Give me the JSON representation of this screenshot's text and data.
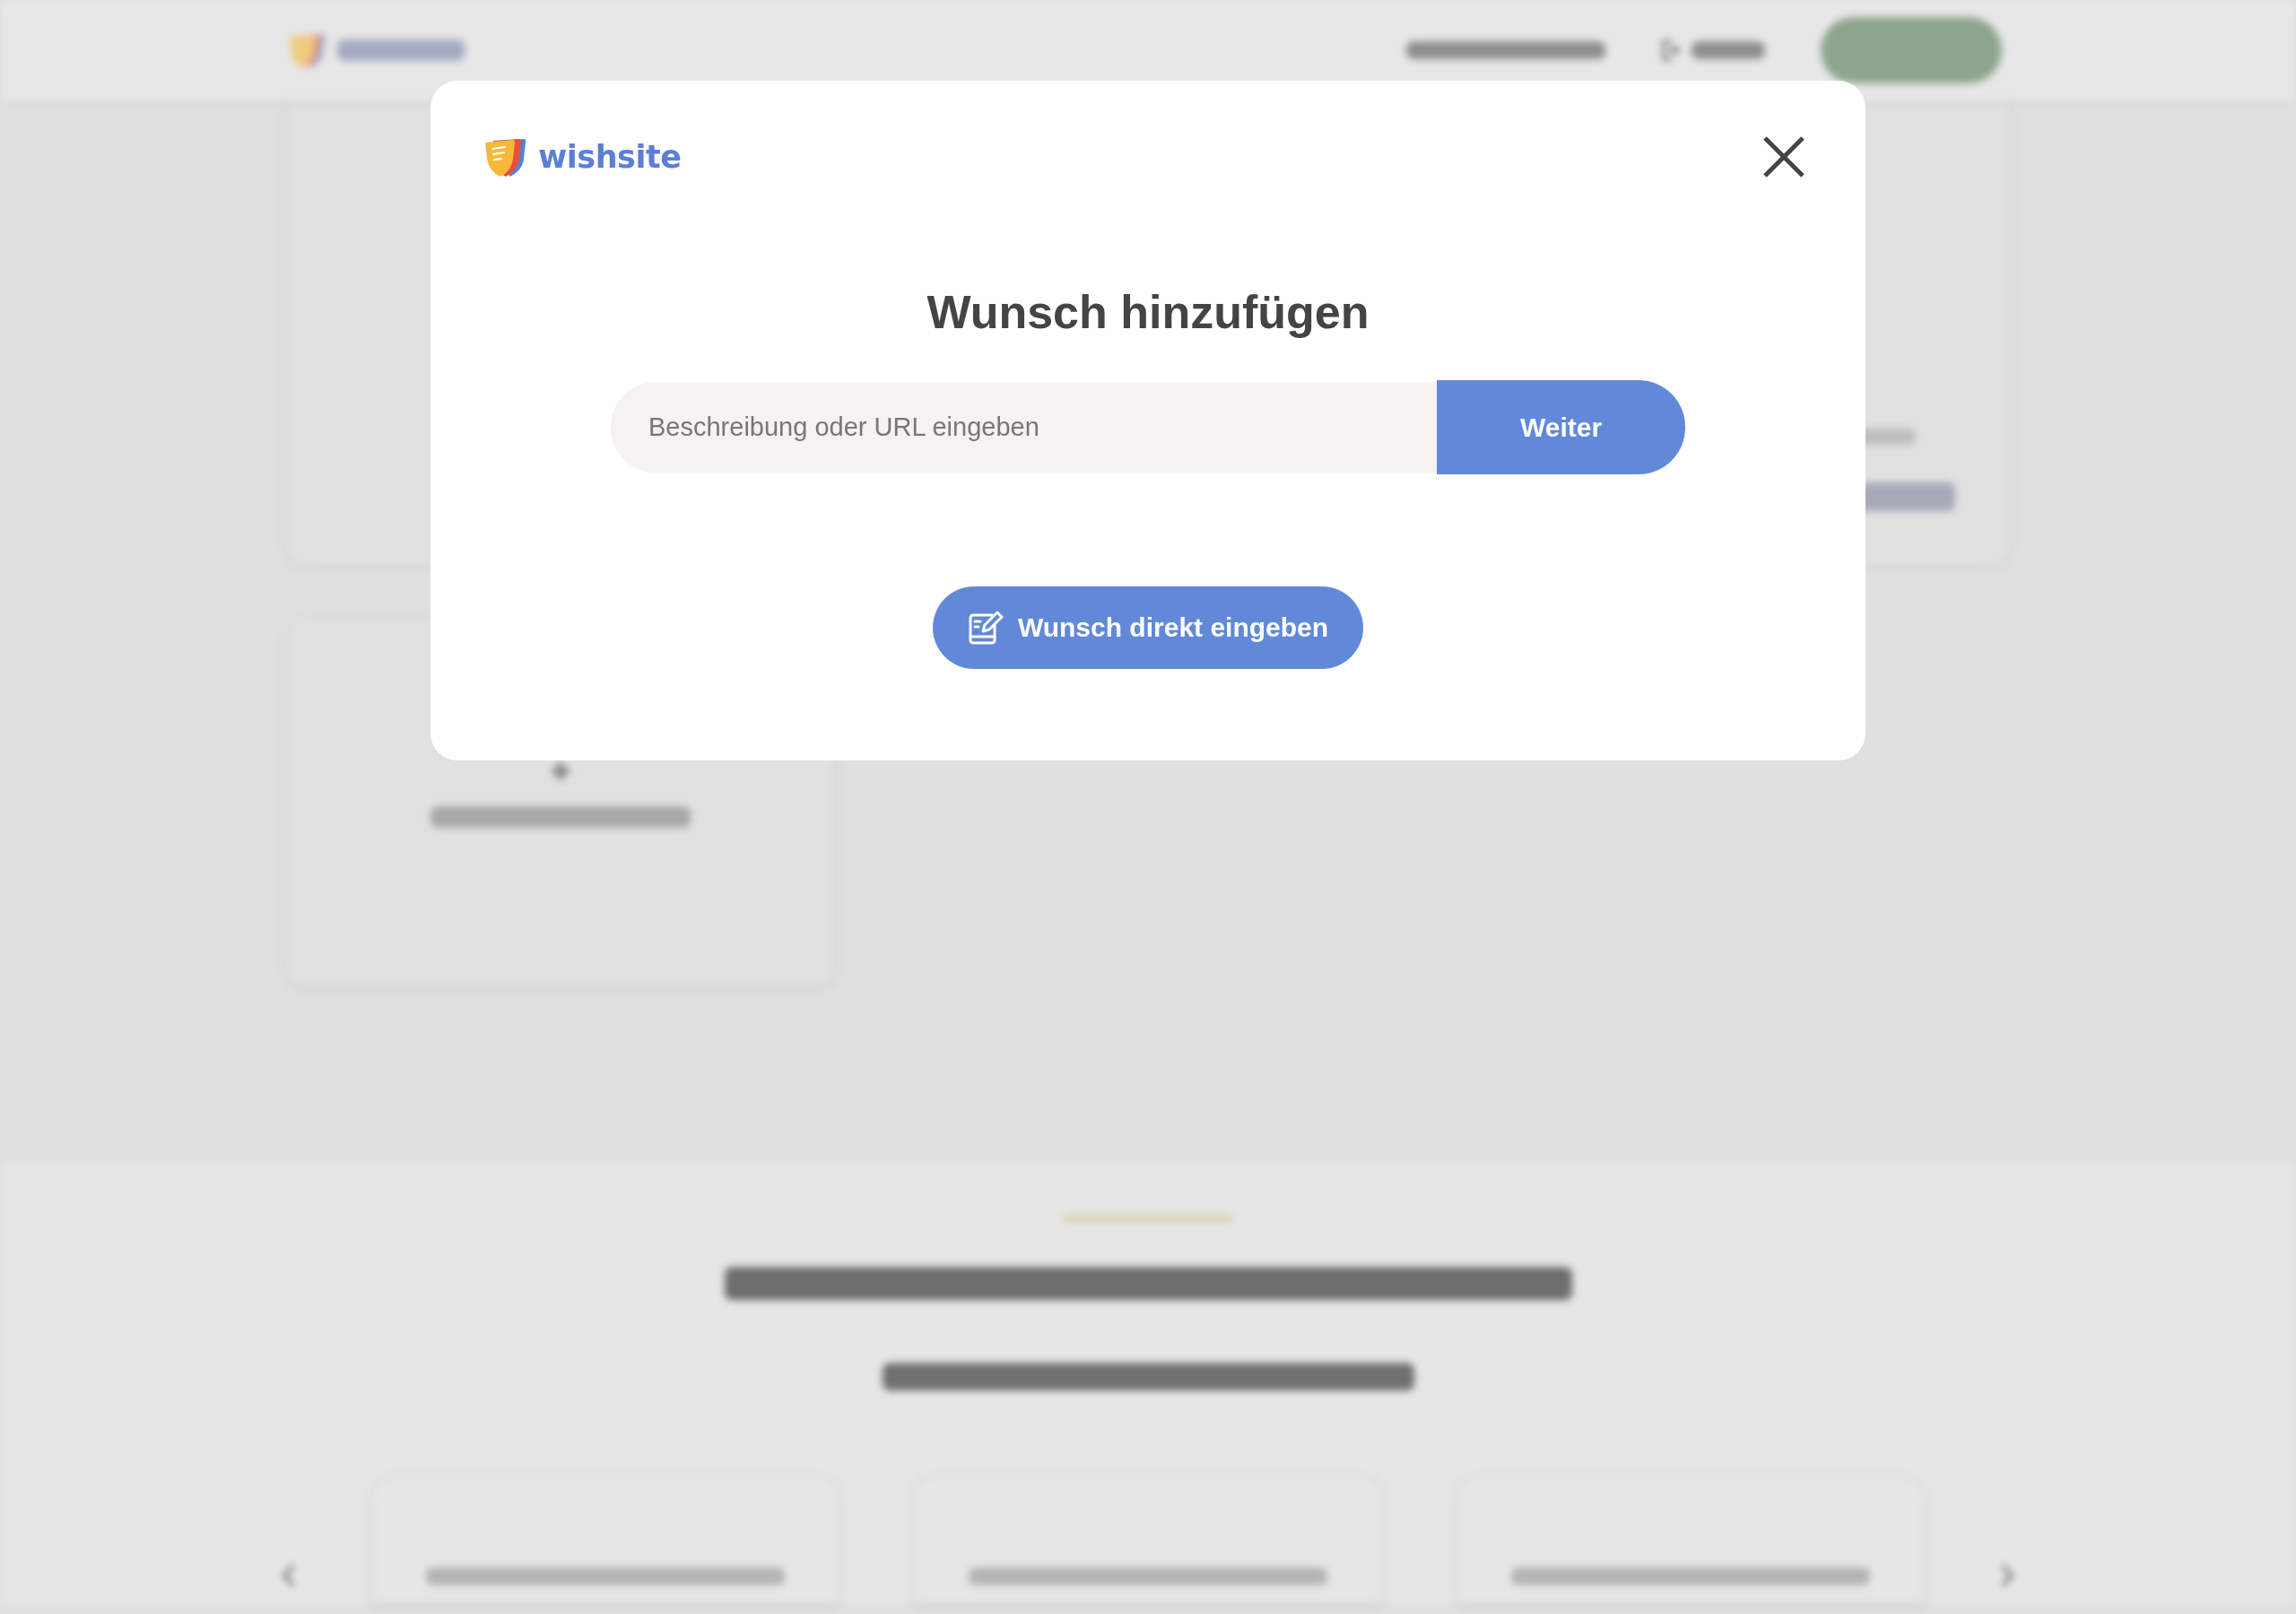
{
  "modal": {
    "logo_text": "wishsite",
    "title": "Wunsch hinzufügen",
    "input": {
      "placeholder": "Beschreibung oder URL eingeben"
    },
    "submit_button": "Weiter",
    "direct_button": "Wunsch direkt eingeben"
  }
}
